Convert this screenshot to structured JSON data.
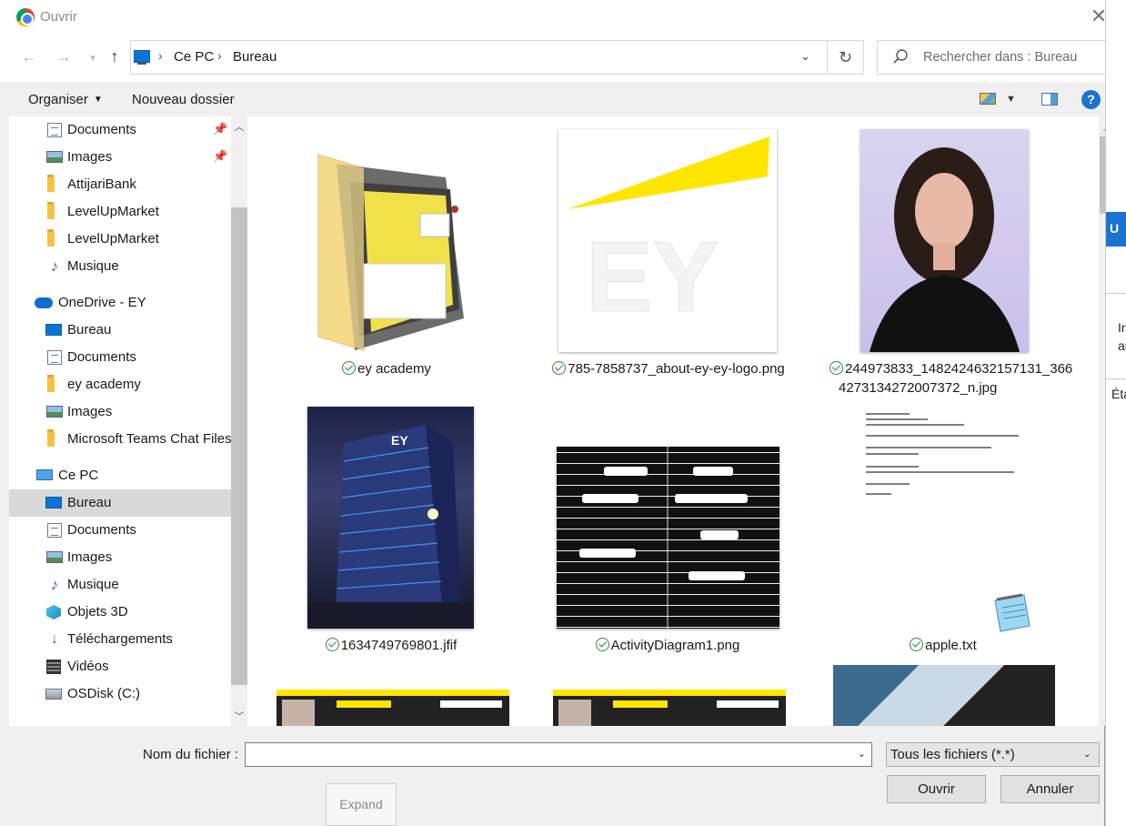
{
  "window": {
    "title": "Ouvrir"
  },
  "address": {
    "crumbs": [
      "Ce PC",
      "Bureau"
    ]
  },
  "search": {
    "placeholder": "Rechercher dans : Bureau"
  },
  "toolbar": {
    "organize": "Organiser",
    "new_folder": "Nouveau dossier"
  },
  "sidebar": {
    "items": [
      {
        "label": "Documents",
        "icon": "documents-icon",
        "pinned": true
      },
      {
        "label": "Images",
        "icon": "images-icon",
        "pinned": true
      },
      {
        "label": "AttijariBank",
        "icon": "folder-icon"
      },
      {
        "label": "LevelUpMarket",
        "icon": "folder-icon"
      },
      {
        "label": "LevelUpMarket",
        "icon": "folder-icon"
      },
      {
        "label": "Musique",
        "icon": "music-icon"
      },
      {
        "label": "OneDrive - EY",
        "icon": "onedrive-icon"
      },
      {
        "label": "Bureau",
        "icon": "desktop-icon"
      },
      {
        "label": "Documents",
        "icon": "documents-icon"
      },
      {
        "label": "ey academy",
        "icon": "folder-icon"
      },
      {
        "label": "Images",
        "icon": "images-icon"
      },
      {
        "label": "Microsoft Teams Chat Files",
        "icon": "folder-icon"
      },
      {
        "label": "Ce PC",
        "icon": "computer-icon"
      },
      {
        "label": "Bureau",
        "icon": "desktop-icon",
        "selected": true
      },
      {
        "label": "Documents",
        "icon": "documents-icon"
      },
      {
        "label": "Images",
        "icon": "images-icon"
      },
      {
        "label": "Musique",
        "icon": "music-icon"
      },
      {
        "label": "Objets 3D",
        "icon": "3d-objects-icon"
      },
      {
        "label": "Téléchargements",
        "icon": "downloads-icon"
      },
      {
        "label": "Vidéos",
        "icon": "videos-icon"
      },
      {
        "label": "OSDisk (C:)",
        "icon": "disk-icon"
      }
    ]
  },
  "files": [
    {
      "name": "ey academy",
      "kind": "folder"
    },
    {
      "name": "785-7858737_about-ey-ey-logo.png",
      "kind": "image"
    },
    {
      "name_line1": "244973833_1482424632157131_366",
      "name_line2": "4273134272007372_n.jpg",
      "kind": "image"
    },
    {
      "name": "1634749769801.jfif",
      "kind": "image"
    },
    {
      "name": "ActivityDiagram1.png",
      "kind": "image"
    },
    {
      "name": "apple.txt",
      "kind": "text"
    }
  ],
  "bottom": {
    "filename_label": "Nom du fichier :",
    "filename_value": "",
    "filter": "Tous les fichiers (*.*)",
    "open": "Ouvrir",
    "cancel": "Annuler",
    "expand": "Expand"
  },
  "bg_window": {
    "tab": "U",
    "text1": "Ir",
    "text2": "au",
    "text3": "Éta"
  },
  "colors": {
    "accent": "#0a74d1",
    "selected": "#d9d9d9",
    "sync_ok": "#2e8b3c"
  }
}
